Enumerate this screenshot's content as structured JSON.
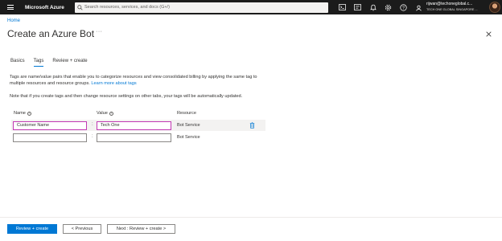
{
  "topbar": {
    "brand": "Microsoft Azure",
    "search_placeholder": "Search resources, services, and docs (G+/)",
    "icons": [
      "cloud-shell-icon",
      "directory-filter-icon",
      "notifications-icon",
      "settings-icon",
      "help-icon",
      "feedback-icon"
    ],
    "account_email": "rijwan@techoneglobal.c...",
    "account_org": "TECH ONE GLOBAL SINGAPORE ..."
  },
  "breadcrumb": {
    "home": "Home"
  },
  "header": {
    "title": "Create an Azure Bot",
    "more": "···"
  },
  "tabs": [
    {
      "label": "Basics"
    },
    {
      "label": "Tags"
    },
    {
      "label": "Review + create"
    }
  ],
  "description": {
    "text": "Tags are name/value pairs that enable you to categorize resources and view consolidated billing by applying the same tag to multiple resources and resource groups.",
    "link": "Learn more about tags"
  },
  "note": "Note that if you create tags and then change resource settings on other tabs, your tags will be automatically updated.",
  "table": {
    "headers": {
      "name": "Name",
      "value": "Value",
      "resource": "Resource"
    },
    "separator": ":",
    "rows": [
      {
        "name": "Customer Name",
        "value": "Tech One",
        "resource": "Bot Service"
      },
      {
        "name": "",
        "value": "",
        "resource": "Bot Service"
      }
    ]
  },
  "footer": {
    "review_create": "Review + create",
    "previous": "< Previous",
    "next": "Next : Review + create >"
  },
  "colors": {
    "accent": "#0078d4",
    "topbar": "#1b1b1b",
    "focus": "#c239b3"
  }
}
